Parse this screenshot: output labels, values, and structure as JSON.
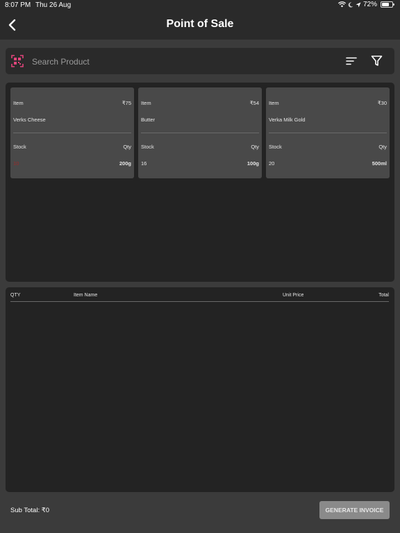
{
  "status_bar": {
    "time": "8:07 PM",
    "date": "Thu 26 Aug",
    "battery_text": "72%",
    "battery_level": 0.72
  },
  "header": {
    "title": "Point of Sale",
    "back_icon": "chevron-left-icon"
  },
  "search": {
    "placeholder": "Search Product",
    "value": "",
    "scan_icon": "qr-scan-icon",
    "sort_icon": "sort-icon",
    "filter_icon": "filter-icon"
  },
  "products": [
    {
      "item_label": "Item",
      "price": "₹75",
      "name": "Verks Cheese",
      "stock_label": "Stock",
      "qty_label": "Qty",
      "stock": "10",
      "qty": "200g",
      "stock_color": "#9b2a2a"
    },
    {
      "item_label": "Item",
      "price": "₹54",
      "name": "Butter",
      "stock_label": "Stock",
      "qty_label": "Qty",
      "stock": "16",
      "qty": "100g",
      "stock_color": "#e6e6e6"
    },
    {
      "item_label": "Item",
      "price": "₹30",
      "name": "Verka Milk Gold",
      "stock_label": "Stock",
      "qty_label": "Qty",
      "stock": "20",
      "qty": "500ml",
      "stock_color": "#e6e6e6"
    }
  ],
  "cart": {
    "columns": {
      "qty": "QTY",
      "item_name": "Item Name",
      "unit_price": "Unit Price",
      "total": "Total"
    },
    "rows": []
  },
  "footer": {
    "subtotal": "Sub Total: ₹0",
    "generate_label": "GENERATE INVOICE"
  },
  "colors": {
    "accent": "#e0457b",
    "background": "#3b3b3b",
    "panel": "#232323",
    "card": "#494949"
  }
}
